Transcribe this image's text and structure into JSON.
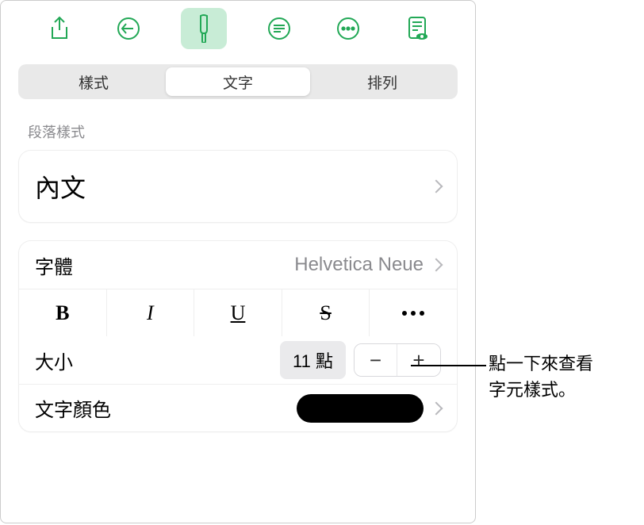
{
  "toolbar": {
    "icons": [
      "share",
      "undo",
      "format-brush",
      "text-lines",
      "more-circle",
      "page-notes"
    ],
    "active_index": 2
  },
  "tabs": {
    "items": [
      "樣式",
      "文字",
      "排列"
    ],
    "active_index": 1
  },
  "paragraph_section": {
    "label": "段落樣式",
    "style_name": "內文"
  },
  "font_row": {
    "label": "字體",
    "value": "Helvetica Neue"
  },
  "format_buttons": {
    "bold": "B",
    "italic": "I",
    "underline": "U",
    "strike": "S"
  },
  "size_row": {
    "label": "大小",
    "value": "11 點",
    "minus": "−",
    "plus": "+"
  },
  "color_row": {
    "label": "文字顏色",
    "swatch_hex": "#000000"
  },
  "callout": {
    "line1": "點一下來查看",
    "line2": "字元樣式。"
  }
}
